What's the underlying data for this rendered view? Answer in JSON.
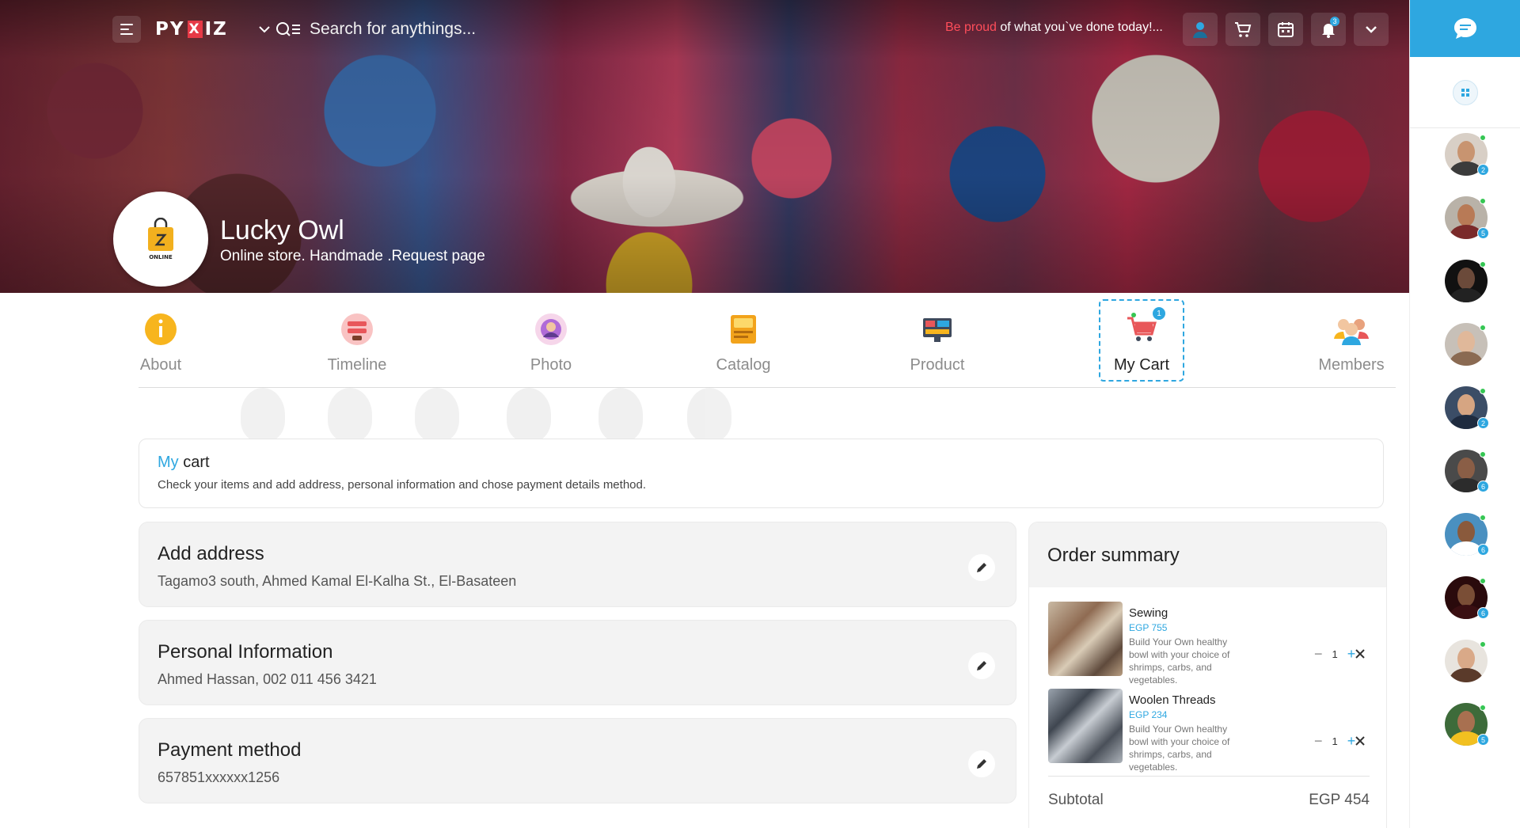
{
  "header": {
    "logo_left": "PY",
    "logo_x": "X",
    "logo_right": "IZ",
    "search_placeholder": "Search for anythings...",
    "motto_accent": "Be proud",
    "motto_rest": " of what you`ve done today!...",
    "notification_count": "3",
    "cart_count": ""
  },
  "profile": {
    "name": "Lucky Owl",
    "subtitle": "Online store. Handmade .Request page",
    "logo_text": "ONLINE"
  },
  "tabs": [
    {
      "label": "About",
      "icon": "info-icon"
    },
    {
      "label": "Timeline",
      "icon": "timeline-icon"
    },
    {
      "label": "Photo",
      "icon": "photo-icon"
    },
    {
      "label": "Catalog",
      "icon": "catalog-icon"
    },
    {
      "label": "Product",
      "icon": "product-icon"
    },
    {
      "label": "My Cart",
      "icon": "cart-icon",
      "badge": "1"
    },
    {
      "label": "Members",
      "icon": "members-icon"
    }
  ],
  "cart": {
    "title_accent": "My",
    "title_rest": " cart",
    "description": "Check your items and add address, personal information and chose payment details method."
  },
  "address": {
    "title": "Add address",
    "value": "Tagamo3 south, Ahmed Kamal El-Kalha St., El-Basateen"
  },
  "personal": {
    "title": "Personal Information",
    "value": "Ahmed Hassan, 002 011 456 3421"
  },
  "payment": {
    "title": "Payment method",
    "value": "657851xxxxxx1256"
  },
  "summary": {
    "title": "Order summary",
    "items": [
      {
        "name": "Sewing",
        "price": "EGP 755",
        "desc": "Build Your Own healthy bowl with your choice of shrimps, carbs, and vegetables.",
        "qty": "1"
      },
      {
        "name": "Woolen Threads",
        "price": "EGP 234",
        "desc": "Build Your Own healthy bowl with your choice of shrimps, carbs, and vegetables.",
        "qty": "1"
      }
    ],
    "subtotal_label": "Subtotal",
    "subtotal_value": "EGP 454"
  },
  "contacts": [
    {
      "count": "2"
    },
    {
      "count": "5"
    },
    {
      "count": ""
    },
    {
      "count": ""
    },
    {
      "count": "2"
    },
    {
      "count": "6"
    },
    {
      "count": "6"
    },
    {
      "count": "6"
    },
    {
      "count": ""
    },
    {
      "count": "5"
    }
  ],
  "colors": {
    "accent": "#2ea7e0",
    "motto_accent": "#ff4d5a",
    "panel": "#f3f3f3"
  }
}
